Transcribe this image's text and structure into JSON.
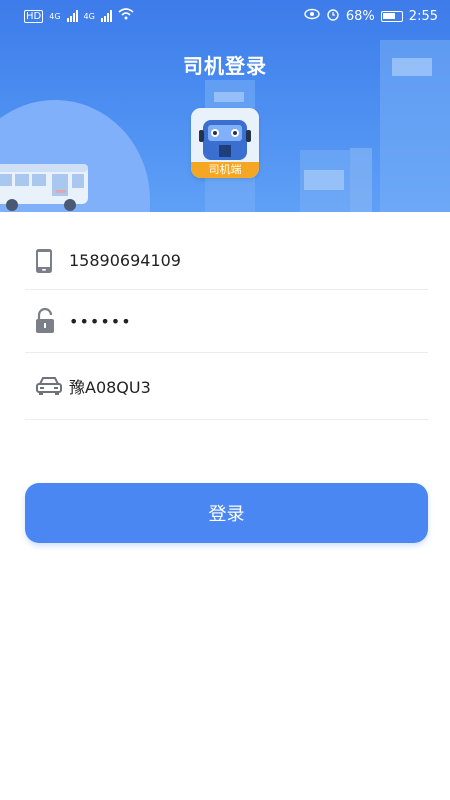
{
  "status_bar": {
    "network_left": "HD",
    "signal1_label": "4G",
    "signal2_label": "4G",
    "battery_percent": "68%",
    "time": "2:55"
  },
  "header": {
    "title": "司机登录",
    "logo_label": "司机端"
  },
  "form": {
    "phone_value": "15890694109",
    "password_value": "••••••",
    "plate_value": "豫A08QU3"
  },
  "login_button_label": "登录",
  "colors": {
    "primary": "#4a87f3",
    "banner_top": "#3d7bea",
    "logo_accent": "#f5a623"
  }
}
